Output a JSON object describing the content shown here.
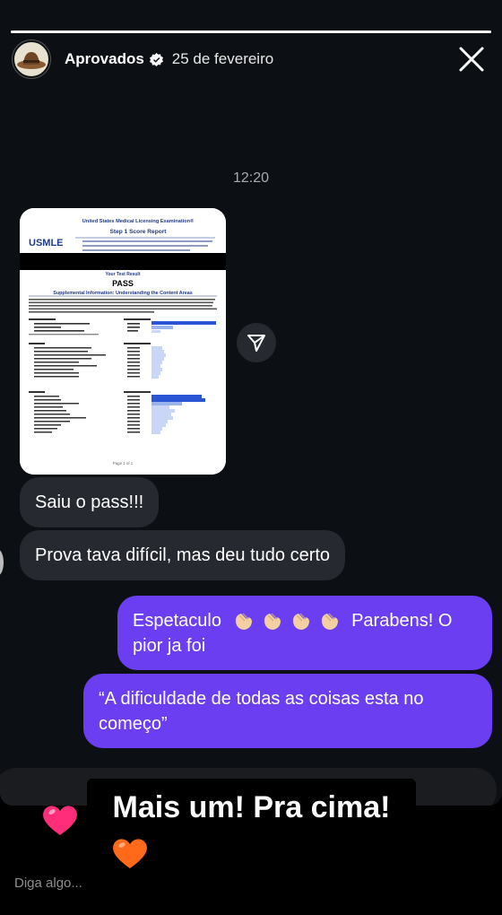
{
  "header": {
    "username": "Aprovados",
    "date": "25 de fevereiro"
  },
  "story": {
    "progress": {
      "segments": 2,
      "current_segment_fill": 1.0
    }
  },
  "chat": {
    "timestamp": "12:20",
    "document": {
      "title_line1": "United States Medical Licensing Examination®",
      "title_line2": "Step 1 Score Report",
      "logo": "USMLE",
      "result_heading": "Your Test Result",
      "result": "PASS",
      "supplemental_title": "Supplemental Information: Understanding the Content Areas",
      "footer": "Page 1 of 1"
    },
    "messages_in": [
      "Saiu o pass!!!",
      "Prova tava difícil, mas deu tudo certo"
    ],
    "messages_out": [
      {
        "line1_start": "Espetaculo",
        "line1_end": "Parabens! O",
        "line2": "pior ja foi"
      },
      {
        "line1": "“A dificuldade de todas as coisas esta no",
        "line2": "começo”"
      }
    ]
  },
  "caption": {
    "text": "Mais um! Pra cima!"
  },
  "reply": {
    "placeholder": "Diga algo..."
  },
  "colors": {
    "outgoing_bubble": "#6b3ef2",
    "incoming_bubble": "#262a30",
    "background": "#0c1014",
    "heart_pink": "#ff2d7a",
    "heart_orange": "#ff6a1a"
  },
  "icons": [
    "verified-icon",
    "close-icon",
    "share-icon",
    "clap-emoji",
    "heart-sticker"
  ]
}
